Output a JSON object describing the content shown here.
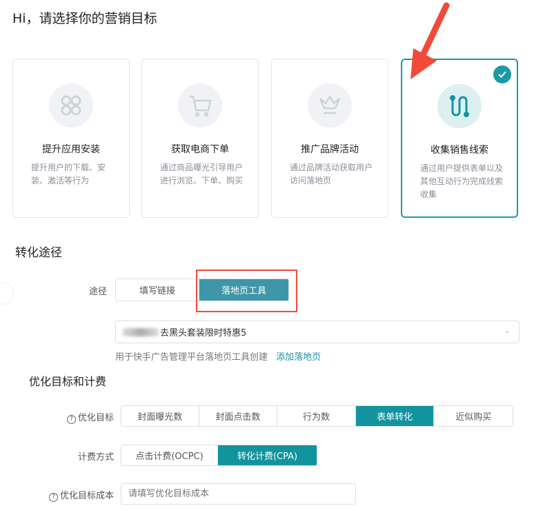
{
  "title": "Hi，请选择你的营销目标",
  "cards": [
    {
      "title": "提升应用安装",
      "desc": "提升用户的下载、安装、激活等行为",
      "icon": "app-grid-icon"
    },
    {
      "title": "获取电商下单",
      "desc": "通过商品曝光引导用户进行浏览、下单、购买",
      "icon": "cart-icon"
    },
    {
      "title": "推广品牌活动",
      "desc": "通过品牌活动获取用户访问落地页",
      "icon": "crown-icon"
    },
    {
      "title": "收集销售线索",
      "desc": "通过用户提供表单以及其他互动行为完成线索收集",
      "icon": "path-icon",
      "selected": true
    }
  ],
  "conversion": {
    "heading": "转化途径",
    "path_label": "途径",
    "options": [
      "填写链接",
      "落地页工具"
    ],
    "selected": "落地页工具",
    "page_value": "去黑头套装限时特惠5",
    "helper": "用于快手广告管理平台落地页工具创建",
    "add_link": "添加落地页"
  },
  "optimize": {
    "heading": "优化目标和计费",
    "goal_label": "优化目标",
    "goals": [
      "封面曝光数",
      "封面点击数",
      "行为数",
      "表单转化",
      "近似购买"
    ],
    "goal_selected": "表单转化",
    "billing_label": "计费方式",
    "billing": [
      "点击计费(OCPC)",
      "转化计费(CPA)"
    ],
    "billing_selected": "转化计费(CPA)",
    "cost_label": "优化目标成本",
    "cost_placeholder": "请填写优化目标成本"
  },
  "colors": {
    "accent": "#12949f",
    "annotation": "#f04a3a"
  }
}
